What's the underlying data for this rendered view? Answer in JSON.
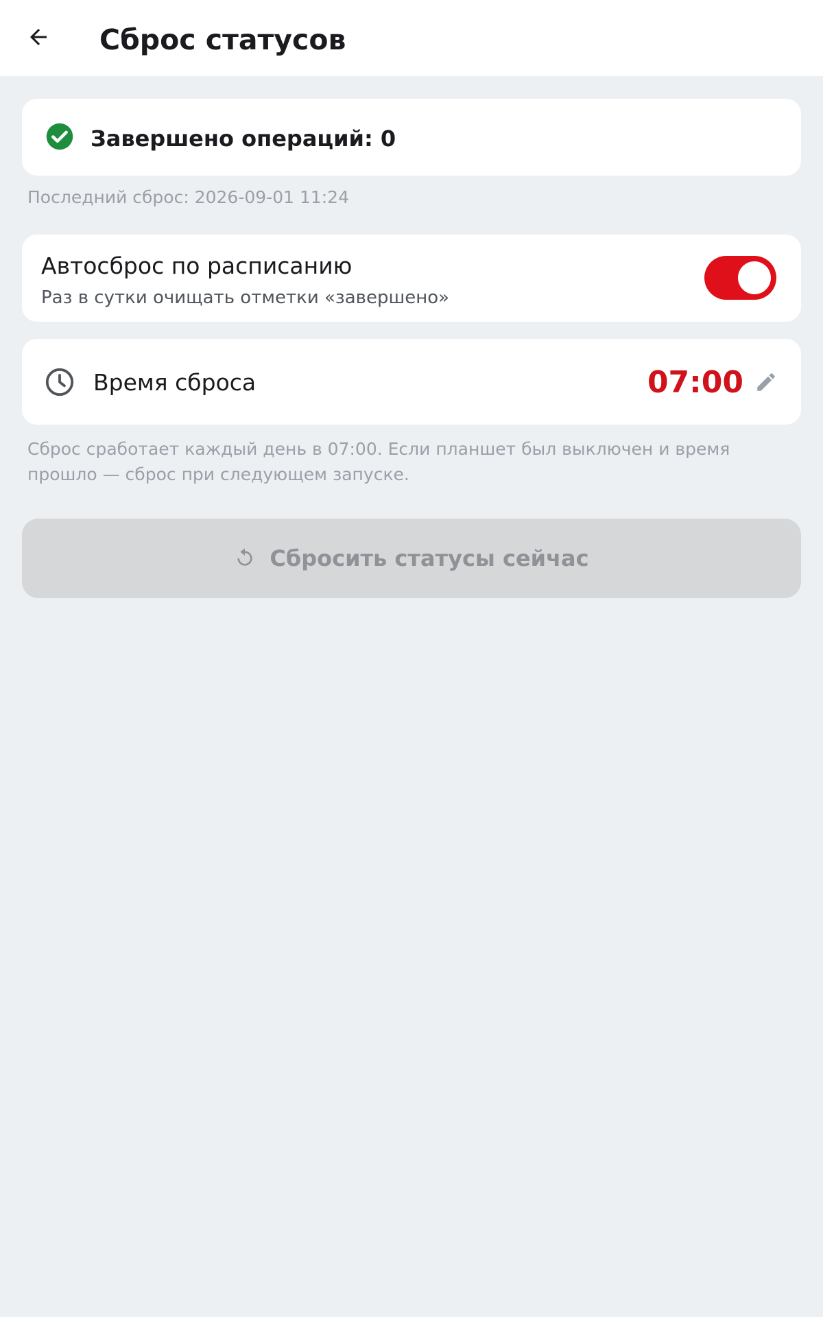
{
  "app_bar": {
    "title": "Сброс статусов",
    "back_icon": "arrow-left-icon"
  },
  "operations": {
    "text": "Завершено операций: 0",
    "icon": "check-circle-icon",
    "icon_color": "#1e8e3e"
  },
  "last_reset": "Последний сброс: 2026-09-01 11:24",
  "auto_reset": {
    "title": "Автосброс по расписанию",
    "subtitle": "Раз в сутки очищать отметки «завершено»",
    "enabled": true,
    "toggle_color": "#e0101a"
  },
  "reset_time": {
    "label": "Время сброса",
    "value": "07:00",
    "icon": "clock-icon",
    "edit_icon": "pencil-icon",
    "value_color": "#d0121b"
  },
  "hint": "Сброс сработает каждый день в 07:00. Если планшет был выключен и время прошло — сброс при следующем запуске.",
  "reset_button": {
    "label": "Сбросить статусы сейчас",
    "icon": "refresh-icon",
    "disabled": true
  }
}
